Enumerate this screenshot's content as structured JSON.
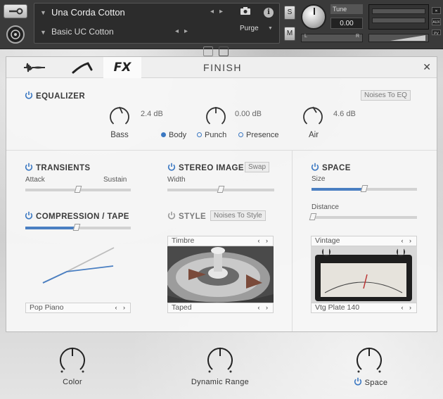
{
  "header": {
    "instrument_name": "Una Corda Cotton",
    "preset_name": "Basic UC Cotton",
    "purge_label": "Purge",
    "s_label": "S",
    "m_label": "M",
    "tune_label": "Tune",
    "tune_value": "0.00",
    "left_label": "L",
    "right_label": "R",
    "aux_label": "AUX",
    "pv_label": "PV"
  },
  "tabs": {
    "fx_label": "FX",
    "finish_label": "FINISH"
  },
  "equalizer": {
    "title": "EQUALIZER",
    "noises_button": "Noises To EQ",
    "bass": {
      "label": "Bass",
      "value": "2.4 dB"
    },
    "mid": {
      "value": "0.00 dB"
    },
    "air": {
      "label": "Air",
      "value": "4.6 dB"
    },
    "modes": [
      "Body",
      "Punch",
      "Presence"
    ],
    "selected_mode": "Body"
  },
  "transients": {
    "title": "TRANSIENTS",
    "left_label": "Attack",
    "right_label": "Sustain",
    "position": 0.5
  },
  "stereo_image": {
    "title": "STEREO IMAGE",
    "swap_button": "Swap",
    "width_label": "Width",
    "position": 0.5
  },
  "space": {
    "title": "SPACE",
    "size_label": "Size",
    "size_value": 0.5,
    "distance_label": "Distance",
    "distance_value": 0.0,
    "preset_header": "Vintage",
    "preset_name": "Vtg Plate 140"
  },
  "compression": {
    "title": "COMPRESSION / TAPE",
    "amount": 0.5,
    "preset": "Pop Piano"
  },
  "style": {
    "title": "STYLE",
    "noises_button": "Noises To Style",
    "timbre_label": "Timbre",
    "tape_label": "Taped"
  },
  "macros": [
    {
      "label": "Color"
    },
    {
      "label": "Dynamic Range"
    },
    {
      "label": "Space"
    }
  ],
  "colors": {
    "accent": "#3b78c2",
    "panel": "#f6f6f6"
  }
}
